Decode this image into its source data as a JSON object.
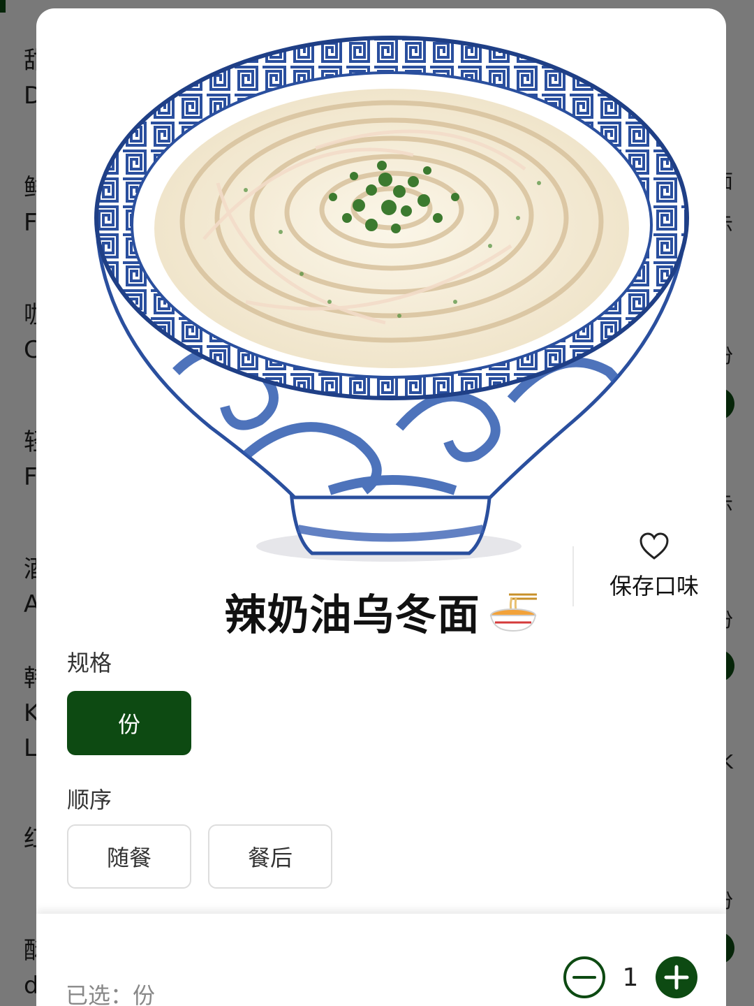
{
  "dish": {
    "name": "辣奶油乌冬面",
    "emoji_icon": "noodle-bowl-icon"
  },
  "save": {
    "label": "保存口味",
    "icon": "heart-outline-icon"
  },
  "spec": {
    "label": "规格",
    "options": [
      "份"
    ],
    "selected_index": 0
  },
  "order": {
    "label": "顺序",
    "options": [
      "随餐",
      "餐后"
    ]
  },
  "footer": {
    "selected_text": "已选：份",
    "quantity": "1"
  },
  "colors": {
    "accent": "#0d4a12",
    "border": "#dddddd",
    "muted_text": "#888888"
  },
  "background_menu": {
    "left_fragments": [
      "甜",
      "D",
      "鲜",
      "F",
      "咖",
      "C",
      "轻",
      "F",
      "酒",
      "A",
      "韩",
      "K",
      "L",
      "红",
      "酥",
      "d"
    ],
    "right_fragments": [
      "面",
      "示",
      "份",
      "示",
      "份",
      "K",
      "份"
    ]
  }
}
